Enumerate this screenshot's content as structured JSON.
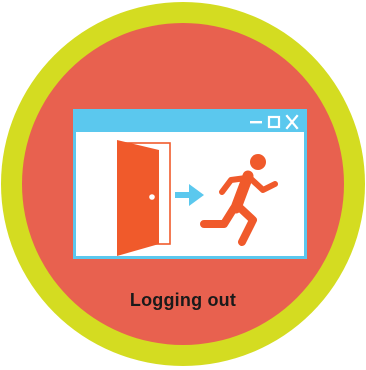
{
  "caption": "Logging out",
  "colors": {
    "ring": "#d4dc21",
    "badge": "#e8614f",
    "window_frame": "#5bc8ee",
    "door": "#f05a2b",
    "arrow": "#5bc8ee",
    "runner": "#f05a2b"
  },
  "icons": {
    "minimize": "minimize-icon",
    "maximize": "maximize-icon",
    "close": "close-icon",
    "door": "door-icon",
    "arrow": "arrow-right-icon",
    "runner": "running-person-icon"
  }
}
